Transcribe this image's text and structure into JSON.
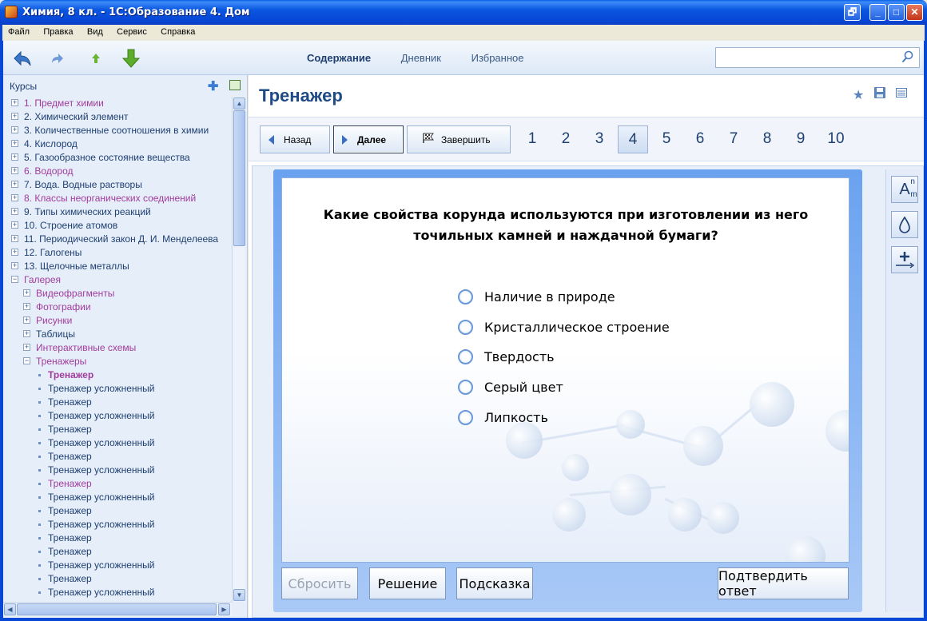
{
  "window": {
    "title": "Химия, 8 кл. - 1С:Образование 4. Дом",
    "buttons": {
      "restore": "🗗",
      "minimize": "_",
      "maximize": "□",
      "close": "✕"
    }
  },
  "menu": [
    "Файл",
    "Правка",
    "Вид",
    "Сервис",
    "Справка"
  ],
  "toolbar": {
    "nav_links": [
      "Содержание",
      "Дневник",
      "Избранное"
    ],
    "active_link": "Содержание",
    "search_placeholder": ""
  },
  "sidebar": {
    "title": "Курсы",
    "items": [
      {
        "label": "1. Предмет химии",
        "level": 0,
        "expander": "+",
        "style": "purple"
      },
      {
        "label": "2. Химический элемент",
        "level": 0,
        "expander": "+",
        "style": "blue"
      },
      {
        "label": "3. Количественные соотношения в химии",
        "level": 0,
        "expander": "+",
        "style": "blue"
      },
      {
        "label": "4. Кислород",
        "level": 0,
        "expander": "+",
        "style": "blue"
      },
      {
        "label": "5. Газообразное состояние вещества",
        "level": 0,
        "expander": "+",
        "style": "blue"
      },
      {
        "label": "6. Водород",
        "level": 0,
        "expander": "+",
        "style": "purple"
      },
      {
        "label": "7. Вода. Водные растворы",
        "level": 0,
        "expander": "+",
        "style": "blue"
      },
      {
        "label": "8. Классы неорганических соединений",
        "level": 0,
        "expander": "+",
        "style": "purple"
      },
      {
        "label": "9. Типы химических реакций",
        "level": 0,
        "expander": "+",
        "style": "blue"
      },
      {
        "label": "10. Строение атомов",
        "level": 0,
        "expander": "+",
        "style": "blue"
      },
      {
        "label": "11. Периодический закон Д. И. Менделеева",
        "level": 0,
        "expander": "+",
        "style": "blue"
      },
      {
        "label": "12. Галогены",
        "level": 0,
        "expander": "+",
        "style": "blue"
      },
      {
        "label": "13. Щелочные металлы",
        "level": 0,
        "expander": "+",
        "style": "blue"
      },
      {
        "label": "Галерея",
        "level": 0,
        "expander": "−",
        "style": "purple"
      },
      {
        "label": "Видеофрагменты",
        "level": 1,
        "expander": "+",
        "style": "purple"
      },
      {
        "label": "Фотографии",
        "level": 1,
        "expander": "+",
        "style": "purple"
      },
      {
        "label": "Рисунки",
        "level": 1,
        "expander": "+",
        "style": "purple"
      },
      {
        "label": "Таблицы",
        "level": 1,
        "expander": "+",
        "style": "blue"
      },
      {
        "label": "Интерактивные схемы",
        "level": 1,
        "expander": "+",
        "style": "purple"
      },
      {
        "label": "Тренажеры",
        "level": 1,
        "expander": "−",
        "style": "purple"
      },
      {
        "label": "Тренажер",
        "level": 2,
        "expander": "",
        "style": "bold"
      },
      {
        "label": "Тренажер усложненный",
        "level": 2,
        "expander": "",
        "style": "blue"
      },
      {
        "label": "Тренажер",
        "level": 2,
        "expander": "",
        "style": "blue"
      },
      {
        "label": "Тренажер усложненный",
        "level": 2,
        "expander": "",
        "style": "blue"
      },
      {
        "label": "Тренажер",
        "level": 2,
        "expander": "",
        "style": "blue"
      },
      {
        "label": "Тренажер усложненный",
        "level": 2,
        "expander": "",
        "style": "blue"
      },
      {
        "label": "Тренажер",
        "level": 2,
        "expander": "",
        "style": "blue"
      },
      {
        "label": "Тренажер усложненный",
        "level": 2,
        "expander": "",
        "style": "blue"
      },
      {
        "label": "Тренажер",
        "level": 2,
        "expander": "",
        "style": "purple"
      },
      {
        "label": "Тренажер усложненный",
        "level": 2,
        "expander": "",
        "style": "blue"
      },
      {
        "label": "Тренажер",
        "level": 2,
        "expander": "",
        "style": "blue"
      },
      {
        "label": "Тренажер усложненный",
        "level": 2,
        "expander": "",
        "style": "blue"
      },
      {
        "label": "Тренажер",
        "level": 2,
        "expander": "",
        "style": "blue"
      },
      {
        "label": "Тренажер",
        "level": 2,
        "expander": "",
        "style": "blue"
      },
      {
        "label": "Тренажер усложненный",
        "level": 2,
        "expander": "",
        "style": "blue"
      },
      {
        "label": "Тренажер",
        "level": 2,
        "expander": "",
        "style": "blue"
      },
      {
        "label": "Тренажер усложненный",
        "level": 2,
        "expander": "",
        "style": "blue"
      }
    ]
  },
  "main": {
    "title": "Тренажер",
    "back_label": "Назад",
    "next_label": "Далее",
    "finish_label": "Завершить",
    "pages": [
      "1",
      "2",
      "3",
      "4",
      "5",
      "6",
      "7",
      "8",
      "9",
      "10"
    ],
    "current_page": "4",
    "question_line1": "Какие свойства корунда используются при изготовлении из него",
    "question_line2": "точильных камней и наждачной бумаги?",
    "options": [
      "Наличие в природе",
      "Кристаллическое строение",
      "Твердость",
      "Серый цвет",
      "Липкость"
    ],
    "buttons": {
      "reset": "Сбросить",
      "solution": "Решение",
      "hint": "Подсказка",
      "confirm": "Подтвердить ответ"
    },
    "tools": {
      "sup_sub_main": "A",
      "sup": "n",
      "sub": "m"
    }
  }
}
